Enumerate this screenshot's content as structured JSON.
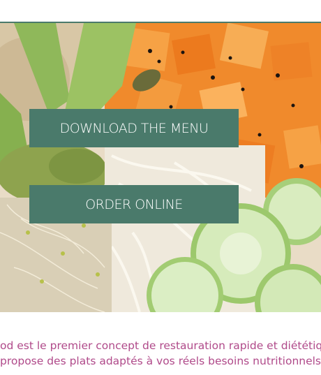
{
  "colors": {
    "accent": "#4a7a6b",
    "button_text": "#ffffff",
    "intro_text": "#b04a8a"
  },
  "hero": {
    "image_subject": "food-bowl-photo"
  },
  "buttons": {
    "download_menu": "DOWNLOAD THE MENU",
    "order_online": "ORDER ONLINE"
  },
  "intro": {
    "line1": "od est le premier concept de restauration rapide et diététique",
    "line2": "propose des plats adaptés à vos réels besoins nutritionnels."
  }
}
